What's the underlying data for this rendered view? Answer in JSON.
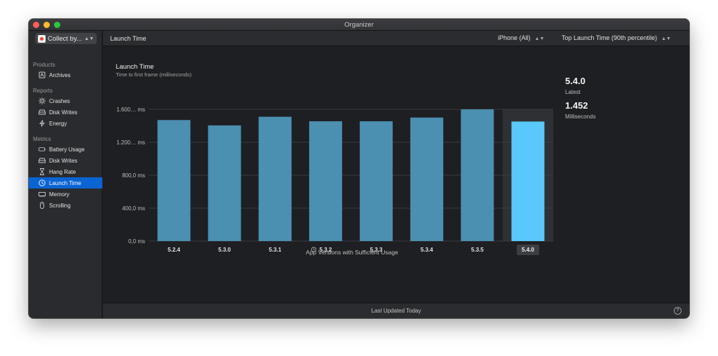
{
  "window": {
    "title": "Organizer"
  },
  "sidebar": {
    "app_picker_label": "Collect by...",
    "sections": [
      {
        "title": "Products",
        "items": [
          {
            "label": "Archives",
            "icon": "archive-icon"
          }
        ]
      },
      {
        "title": "Reports",
        "items": [
          {
            "label": "Crashes",
            "icon": "crash-icon"
          },
          {
            "label": "Disk Writes",
            "icon": "disk-icon"
          },
          {
            "label": "Energy",
            "icon": "bolt-icon"
          }
        ]
      },
      {
        "title": "Metrics",
        "items": [
          {
            "label": "Battery Usage",
            "icon": "battery-icon"
          },
          {
            "label": "Disk Writes",
            "icon": "disk-icon"
          },
          {
            "label": "Hang Rate",
            "icon": "hourglass-icon"
          },
          {
            "label": "Launch Time",
            "icon": "clock-icon",
            "selected": true
          },
          {
            "label": "Memory",
            "icon": "memory-chip-icon"
          },
          {
            "label": "Scrolling",
            "icon": "scroll-icon"
          }
        ]
      }
    ]
  },
  "toolbar": {
    "title": "Launch Time",
    "device_picker": "iPhone (All)",
    "metric_picker": "Top Launch Time (90th percentile)"
  },
  "summary": {
    "version": "5.4.0",
    "version_caption": "Latest",
    "value": "1.452",
    "value_caption": "Milliseconds"
  },
  "statusbar": {
    "text": "Last Updated Today",
    "help": "?"
  },
  "colors": {
    "bar": "#4b8fb1",
    "bar_selected": "#5ac8fa",
    "selection_bg": "#2f3033",
    "grid": "#3a3b3e",
    "sidebar_selected": "#0a64d2"
  },
  "chart_data": {
    "type": "bar",
    "title": "Launch Time",
    "subtitle": "Time to first frame (milliseconds)",
    "xlabel": "App Versions with Sufficient Usage",
    "ylabel": "",
    "categories": [
      "5.2.4",
      "5.3.0",
      "5.3.1",
      "5.3.2",
      "5.3.3",
      "5.3.4",
      "5.3.5",
      "5.4.0"
    ],
    "values": [
      1470,
      1405,
      1510,
      1455,
      1455,
      1500,
      1600,
      1452
    ],
    "category_icons": [
      "",
      "",
      "",
      "clock-icon",
      "",
      "",
      "",
      ""
    ],
    "selected_index": 7,
    "ylim": [
      0,
      1600
    ],
    "yticks": [
      0,
      400,
      800,
      1200,
      1600
    ],
    "ytick_labels": [
      "0,0 ms",
      "400,0 ms",
      "800,0 ms",
      "1.200… ms",
      "1.600… ms"
    ],
    "grid": true
  }
}
